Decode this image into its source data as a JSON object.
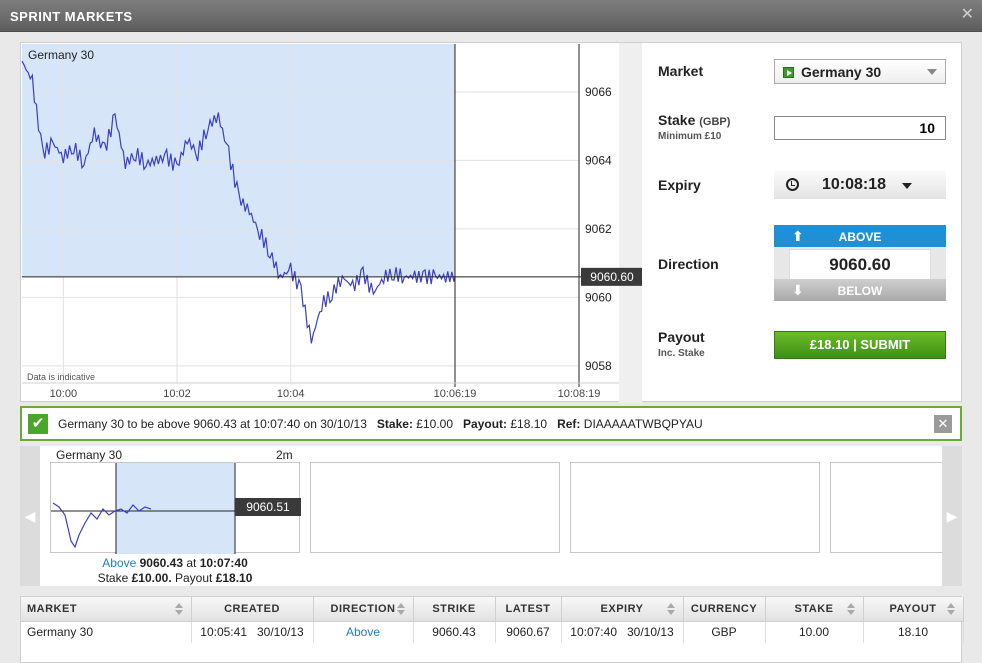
{
  "window": {
    "title": "SPRINT MARKETS",
    "close_icon": "✕"
  },
  "chart": {
    "market_label": "Germany 30",
    "indicative_note": "Data is indicative",
    "current_price": "9060.60",
    "y_ticks": [
      "9066",
      "9064",
      "9062",
      "9060",
      "9058"
    ],
    "x_ticks": [
      "10:00",
      "10:02",
      "10:04",
      "10:06:19",
      "10:08:19"
    ]
  },
  "chart_data": {
    "type": "line",
    "title": "Germany 30",
    "xlabel": "",
    "ylabel": "",
    "ylim": [
      9057.5,
      9067.4
    ],
    "x_range": [
      "09:59:20",
      "10:08:19"
    ],
    "now_marker": {
      "time": "10:06:19",
      "value": 9060.6
    },
    "expiry_marker": "10:08:19",
    "grid": true,
    "series": [
      {
        "x_seconds_from_0959": [
          0,
          10,
          20,
          30,
          40,
          50,
          60,
          70,
          80,
          90,
          100,
          110,
          120,
          130,
          140,
          150,
          160,
          170,
          180,
          190,
          200,
          210,
          220,
          230,
          240,
          250,
          260,
          270,
          280,
          290,
          300,
          310,
          320,
          330,
          340,
          350,
          360,
          370,
          380,
          390,
          400,
          410,
          420,
          430,
          440
        ],
        "values": [
          9066.9,
          9066.3,
          9064.2,
          9064.5,
          9064.1,
          9064.4,
          9063.9,
          9064.8,
          9064.3,
          9065.3,
          9063.9,
          9064.2,
          9063.9,
          9064.0,
          9064.1,
          9063.8,
          9064.6,
          9064.2,
          9065.0,
          9065.3,
          9064.2,
          9062.9,
          9062.5,
          9061.9,
          9061.3,
          9060.6,
          9060.8,
          9060.2,
          9058.7,
          9059.8,
          9060.1,
          9060.6,
          9060.3,
          9060.7,
          9060.1,
          9060.6,
          9060.7,
          9060.6,
          9060.6,
          9060.6,
          9060.6,
          9060.6,
          9060.6,
          9060.6,
          9060.6
        ]
      }
    ]
  },
  "panel": {
    "market_label": "Market",
    "market_value": "Germany 30",
    "stake_label": "Stake",
    "stake_unit": "(GBP)",
    "stake_min": "Minimum £10",
    "stake_value": "10",
    "expiry_label": "Expiry",
    "expiry_value": "10:08:18",
    "direction_label": "Direction",
    "above_label": "ABOVE",
    "below_label": "BELOW",
    "direction_value": "9060.60",
    "payout_label": "Payout",
    "payout_sub": "Inc. Stake",
    "submit_label": "£18.10 | SUBMIT"
  },
  "confirmation": {
    "text": "Germany 30 to be above 9060.43 at 10:07:40 on 30/10/13",
    "stake_label": "Stake:",
    "stake_value": "£10.00",
    "payout_label": "Payout:",
    "payout_value": "£18.10",
    "ref_label": "Ref:",
    "ref_value": "DIAAAAATWBQPYAU"
  },
  "mini": {
    "title": "Germany 30",
    "duration": "2m",
    "price": "9060.51",
    "dir_word": "Above",
    "strike": "9060.43",
    "at_word": "at",
    "time": "10:07:40",
    "stake_word": "Stake",
    "stake": "£10.00.",
    "payout_word": "Payout",
    "payout": "£18.10"
  },
  "table": {
    "headers": [
      "MARKET",
      "CREATED",
      "DIRECTION",
      "STRIKE",
      "LATEST",
      "EXPIRY",
      "CURRENCY",
      "STAKE",
      "PAYOUT"
    ],
    "rows": [
      [
        "Germany 30",
        "10:05:41   30/10/13",
        "Above",
        "9060.43",
        "9060.67",
        "10:07:40   30/10/13",
        "GBP",
        "10.00",
        "18.10"
      ]
    ]
  },
  "colors": {
    "accent_blue": "#1f8fd6",
    "submit_green": "#4a9c1c",
    "chart_fill": "#d6e6f8",
    "line": "#3a3fc6"
  }
}
